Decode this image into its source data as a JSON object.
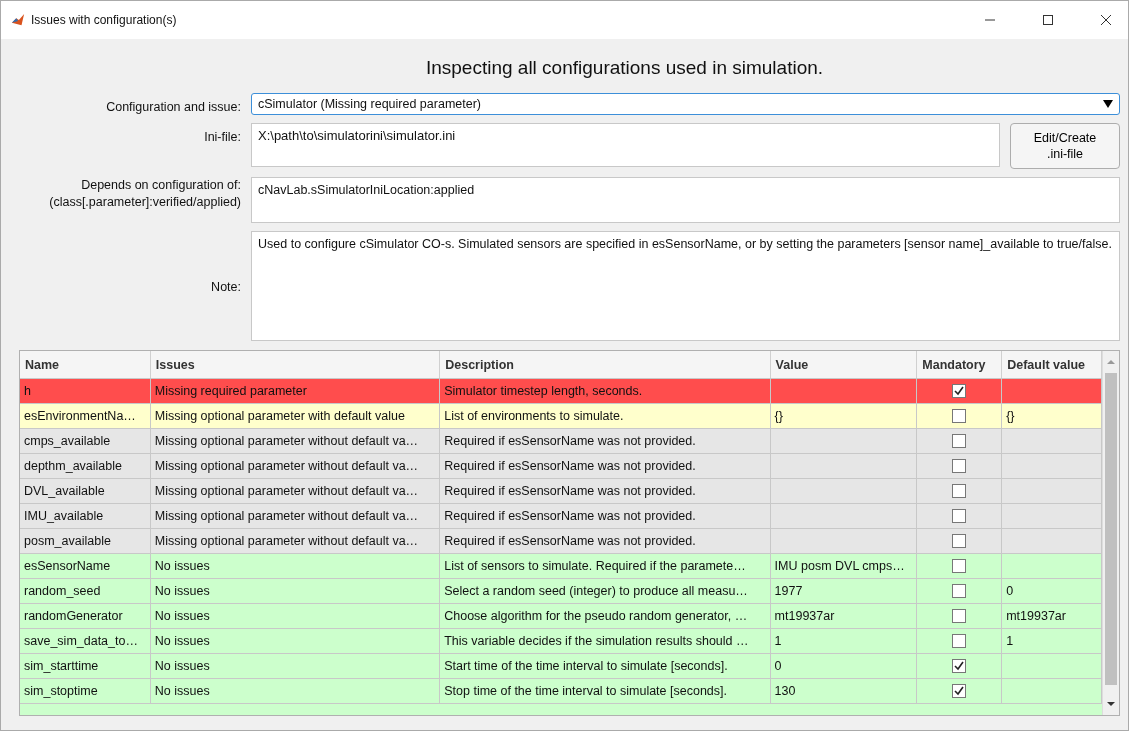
{
  "window": {
    "title": "Issues with configuration(s)"
  },
  "heading": "Inspecting all configurations used in simulation.",
  "config": {
    "label": "Configuration and issue:",
    "value": "cSimulator (Missing required parameter)"
  },
  "ini": {
    "label": "Ini-file:",
    "value": "X:\\path\\to\\simulatorini\\simulator.ini",
    "button": "Edit/Create\n.ini-file"
  },
  "depends": {
    "label": "Depends on configuration of:\n(class[.parameter]:verified/applied)",
    "value": "cNavLab.sSimulatorIniLocation:applied"
  },
  "note": {
    "label": "Note:",
    "value": "Used to configure cSimulator CO-s. Simulated sensors are specified in esSensorName, or by setting the parameters [sensor name]_available to true/false."
  },
  "table": {
    "columns": [
      "Name",
      "Issues",
      "Description",
      "Value",
      "Mandatory",
      "Default value"
    ],
    "rows": [
      {
        "color": "#ff4d4d",
        "name": "h",
        "issue": "Missing required parameter",
        "description": "Simulator timestep length, seconds.",
        "value": "",
        "mandatory": true,
        "default": ""
      },
      {
        "color": "#ffffcc",
        "name": "esEnvironmentNa…",
        "issue": "Missing optional parameter with default value",
        "description": "List of environments to simulate.",
        "value": "{}",
        "mandatory": false,
        "default": "{}"
      },
      {
        "color": "#e6e6e6",
        "name": "cmps_available",
        "issue": "Missing optional parameter without default va…",
        "description": "Required if esSensorName was not provided.",
        "value": "",
        "mandatory": false,
        "default": ""
      },
      {
        "color": "#e6e6e6",
        "name": "depthm_available",
        "issue": "Missing optional parameter without default va…",
        "description": "Required if esSensorName was not provided.",
        "value": "",
        "mandatory": false,
        "default": ""
      },
      {
        "color": "#e6e6e6",
        "name": "DVL_available",
        "issue": "Missing optional parameter without default va…",
        "description": "Required if esSensorName was not provided.",
        "value": "",
        "mandatory": false,
        "default": ""
      },
      {
        "color": "#e6e6e6",
        "name": "IMU_available",
        "issue": "Missing optional parameter without default va…",
        "description": "Required if esSensorName was not provided.",
        "value": "",
        "mandatory": false,
        "default": ""
      },
      {
        "color": "#e6e6e6",
        "name": "posm_available",
        "issue": "Missing optional parameter without default va…",
        "description": "Required if esSensorName was not provided.",
        "value": "",
        "mandatory": false,
        "default": ""
      },
      {
        "color": "#ccffcc",
        "name": "esSensorName",
        "issue": "No issues",
        "description": "List of sensors to simulate. Required if the paramete…",
        "value": "IMU posm DVL cmps…",
        "mandatory": false,
        "default": ""
      },
      {
        "color": "#ccffcc",
        "name": "random_seed",
        "issue": "No issues",
        "description": "Select a random seed (integer) to produce all measu…",
        "value": "1977",
        "mandatory": false,
        "default": "0"
      },
      {
        "color": "#ccffcc",
        "name": "randomGenerator",
        "issue": "No issues",
        "description": "Choose algorithm for the pseudo random generator, …",
        "value": "mt19937ar",
        "mandatory": false,
        "default": "mt19937ar"
      },
      {
        "color": "#ccffcc",
        "name": "save_sim_data_to…",
        "issue": "No issues",
        "description": "This variable decides if the simulation results should …",
        "value": "1",
        "mandatory": false,
        "default": "1"
      },
      {
        "color": "#ccffcc",
        "name": "sim_starttime",
        "issue": "No issues",
        "description": "Start time of the time interval to simulate [seconds].",
        "value": "0",
        "mandatory": true,
        "default": ""
      },
      {
        "color": "#ccffcc",
        "name": "sim_stoptime",
        "issue": "No issues",
        "description": "Stop time of the time interval to simulate [seconds].",
        "value": "130",
        "mandatory": true,
        "default": ""
      }
    ]
  }
}
